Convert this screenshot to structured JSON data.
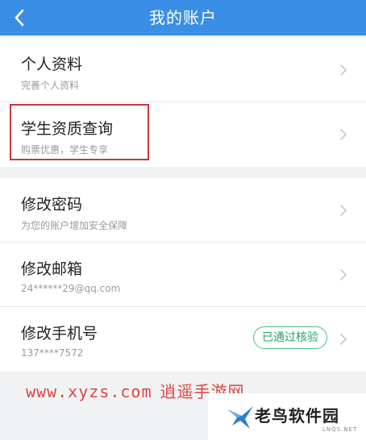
{
  "header": {
    "title": "我的账户",
    "back_icon": "chevron-left-icon",
    "background": "#3a8ee6"
  },
  "rows": [
    {
      "label": "个人资料",
      "sub": "完善个人资料"
    },
    {
      "label": "学生资质查询",
      "sub": "购票优惠，学生专享"
    },
    {
      "label": "修改密码",
      "sub": "为您的账户增加安全保障"
    },
    {
      "label": "修改邮箱",
      "sub": "24******29@qq.com"
    },
    {
      "label": "修改手机号",
      "sub": "137****7572",
      "badge": "已通过核验"
    }
  ],
  "colors": {
    "accent": "#3a8ee6",
    "badge": "#2aa36a",
    "highlight": "#c9363a"
  },
  "watermark": {
    "site": "www.xyzs.com",
    "site_cn": "逍遥手游网",
    "brand": "老鸟软件园",
    "brand_domain": "LNQS.NET"
  }
}
